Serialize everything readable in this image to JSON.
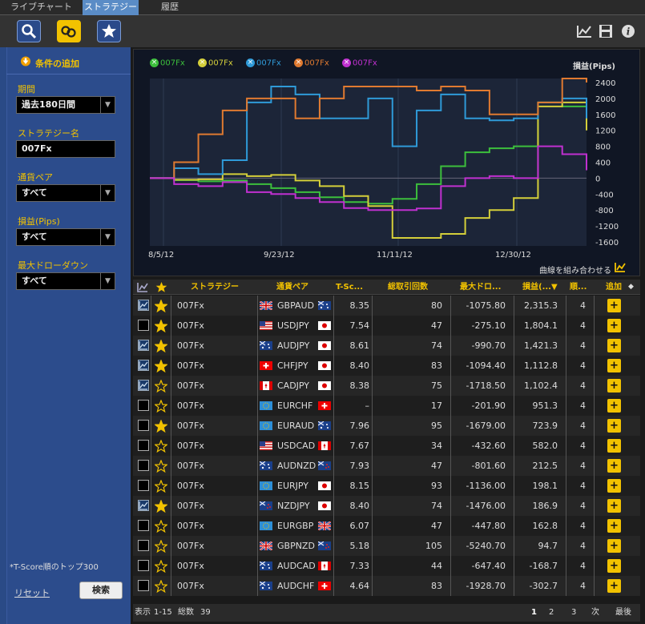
{
  "tabs": [
    {
      "label": "ライブチャート"
    },
    {
      "label": "ストラテジー"
    },
    {
      "label": "履歴"
    }
  ],
  "sidebar": {
    "header": "条件の追加",
    "period_label": "期間",
    "period_value": "過去180日間",
    "strategy_label": "ストラテジー名",
    "strategy_value": "007Fx",
    "pair_label": "通貨ペア",
    "pair_value": "すべて",
    "profit_label": "損益(Pips)",
    "profit_value": "すべて",
    "drawdown_label": "最大ドローダウン",
    "drawdown_value": "すべて",
    "note": "*T-Score順のトップ300",
    "reset": "リセット",
    "search": "検索"
  },
  "chart": {
    "legend": [
      {
        "label": "007Fx",
        "color": "#3cbf3c"
      },
      {
        "label": "007Fx",
        "color": "#d4cf3a"
      },
      {
        "label": "007Fx",
        "color": "#2f9ad8"
      },
      {
        "label": "007Fx",
        "color": "#e07a30"
      },
      {
        "label": "007Fx",
        "color": "#c030d0"
      }
    ],
    "combine_label": "曲線を組み合わせる"
  },
  "chart_data": {
    "type": "line",
    "ylabel": "損益(Pips)",
    "ylim": [
      -1600,
      2400
    ],
    "yticks": [
      "2400",
      "2000",
      "1600",
      "1200",
      "800",
      "400",
      "0",
      "-400",
      "-800",
      "-1200",
      "-1600"
    ],
    "xticks": [
      "8/5/12",
      "9/23/12",
      "11/11/12",
      "12/30/12"
    ],
    "series": [
      {
        "color": "#3cbf3c",
        "values": [
          0,
          -50,
          -80,
          -60,
          -150,
          -250,
          -350,
          -480,
          -600,
          -640,
          -520,
          -150,
          300,
          650,
          750,
          800,
          1900,
          1800,
          1400
        ]
      },
      {
        "color": "#d4cf3a",
        "values": [
          0,
          -40,
          -30,
          100,
          50,
          80,
          -60,
          -200,
          -450,
          -700,
          -1500,
          -1500,
          -1400,
          -1000,
          -800,
          -500,
          1800,
          1900,
          1200
        ]
      },
      {
        "color": "#2f9ad8",
        "values": [
          0,
          250,
          100,
          450,
          1900,
          2300,
          2100,
          1500,
          1500,
          2000,
          800,
          1700,
          2100,
          1500,
          1450,
          1500,
          1900,
          2000,
          1500
        ]
      },
      {
        "color": "#e07a30",
        "values": [
          0,
          400,
          1100,
          1700,
          2000,
          2000,
          1500,
          2000,
          2300,
          2300,
          2300,
          2200,
          2300,
          2200,
          1600,
          1600,
          1900,
          2500,
          2400
        ]
      },
      {
        "color": "#c030d0",
        "values": [
          0,
          -150,
          -200,
          -100,
          -350,
          -400,
          -500,
          -600,
          -750,
          -800,
          -800,
          -760,
          -200,
          0,
          50,
          0,
          800,
          600,
          200
        ]
      }
    ]
  },
  "table": {
    "headers": {
      "strategy": "ストラテジー",
      "pair": "通貨ペア",
      "tscore": "T-Sc...",
      "trades": "総取引回数",
      "maxdd": "最大ドロ...",
      "profit": "損益(...",
      "profit_sort": "▼",
      "rank": "順...",
      "add": "追加"
    },
    "rows": [
      {
        "checked": true,
        "fav": true,
        "name": "007Fx",
        "pair": "GBPAUD",
        "f1": "uk",
        "f2": "au",
        "tscore": "8.35",
        "trades": "80",
        "maxdd": "-1075.80",
        "profit": "2,315.3",
        "rank": "4"
      },
      {
        "checked": false,
        "fav": true,
        "name": "007Fx",
        "pair": "USDJPY",
        "f1": "us",
        "f2": "jp",
        "tscore": "7.54",
        "trades": "47",
        "maxdd": "-275.10",
        "profit": "1,804.1",
        "rank": "4"
      },
      {
        "checked": true,
        "fav": true,
        "name": "007Fx",
        "pair": "AUDJPY",
        "f1": "au",
        "f2": "jp",
        "tscore": "8.61",
        "trades": "74",
        "maxdd": "-990.70",
        "profit": "1,421.3",
        "rank": "4"
      },
      {
        "checked": true,
        "fav": true,
        "name": "007Fx",
        "pair": "CHFJPY",
        "f1": "ch",
        "f2": "jp",
        "tscore": "8.40",
        "trades": "83",
        "maxdd": "-1094.40",
        "profit": "1,112.8",
        "rank": "4"
      },
      {
        "checked": true,
        "fav": false,
        "name": "007Fx",
        "pair": "CADJPY",
        "f1": "ca",
        "f2": "jp",
        "tscore": "8.38",
        "trades": "75",
        "maxdd": "-1718.50",
        "profit": "1,102.4",
        "rank": "4"
      },
      {
        "checked": false,
        "fav": false,
        "name": "007Fx",
        "pair": "EURCHF",
        "f1": "eu",
        "f2": "ch",
        "tscore": "–",
        "trades": "17",
        "maxdd": "-201.90",
        "profit": "951.3",
        "rank": "4"
      },
      {
        "checked": false,
        "fav": true,
        "name": "007Fx",
        "pair": "EURAUD",
        "f1": "eu",
        "f2": "au",
        "tscore": "7.96",
        "trades": "95",
        "maxdd": "-1679.00",
        "profit": "723.9",
        "rank": "4"
      },
      {
        "checked": false,
        "fav": false,
        "name": "007Fx",
        "pair": "USDCAD",
        "f1": "us",
        "f2": "ca",
        "tscore": "7.67",
        "trades": "34",
        "maxdd": "-432.60",
        "profit": "582.0",
        "rank": "4"
      },
      {
        "checked": false,
        "fav": false,
        "name": "007Fx",
        "pair": "AUDNZD",
        "f1": "au",
        "f2": "nz",
        "tscore": "7.93",
        "trades": "47",
        "maxdd": "-801.60",
        "profit": "212.5",
        "rank": "4"
      },
      {
        "checked": false,
        "fav": false,
        "name": "007Fx",
        "pair": "EURJPY",
        "f1": "eu",
        "f2": "jp",
        "tscore": "8.15",
        "trades": "93",
        "maxdd": "-1136.00",
        "profit": "198.1",
        "rank": "4"
      },
      {
        "checked": true,
        "fav": true,
        "name": "007Fx",
        "pair": "NZDJPY",
        "f1": "nz",
        "f2": "jp",
        "tscore": "8.40",
        "trades": "74",
        "maxdd": "-1476.00",
        "profit": "186.9",
        "rank": "4"
      },
      {
        "checked": false,
        "fav": false,
        "name": "007Fx",
        "pair": "EURGBP",
        "f1": "eu",
        "f2": "uk",
        "tscore": "6.07",
        "trades": "47",
        "maxdd": "-447.80",
        "profit": "162.8",
        "rank": "4"
      },
      {
        "checked": false,
        "fav": false,
        "name": "007Fx",
        "pair": "GBPNZD",
        "f1": "uk",
        "f2": "nz",
        "tscore": "5.18",
        "trades": "105",
        "maxdd": "-5240.70",
        "profit": "94.7",
        "rank": "4"
      },
      {
        "checked": false,
        "fav": false,
        "name": "007Fx",
        "pair": "AUDCAD",
        "f1": "au",
        "f2": "ca",
        "tscore": "7.33",
        "trades": "44",
        "maxdd": "-647.40",
        "profit": "-168.7",
        "rank": "4"
      },
      {
        "checked": false,
        "fav": false,
        "name": "007Fx",
        "pair": "AUDCHF",
        "f1": "au",
        "f2": "ch",
        "tscore": "4.64",
        "trades": "83",
        "maxdd": "-1928.70",
        "profit": "-302.7",
        "rank": "4"
      }
    ]
  },
  "footer": {
    "display": "表示",
    "range": "1-15",
    "total_label": "総数",
    "total": "39",
    "pages": [
      "1",
      "2",
      "3"
    ],
    "next": "次",
    "last": "最後"
  }
}
